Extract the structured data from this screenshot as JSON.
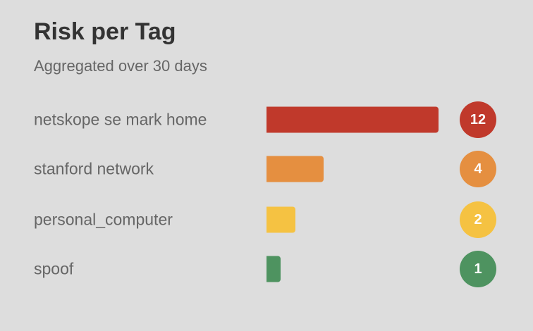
{
  "header": {
    "title": "Risk per Tag",
    "subtitle": "Aggregated over 30 days"
  },
  "chart_data": {
    "type": "bar",
    "orientation": "horizontal",
    "title": "Risk per Tag",
    "subtitle": "Aggregated over 30 days",
    "categories": [
      "netskope se mark home",
      "stanford network",
      "personal_computer",
      "spoof"
    ],
    "values": [
      12,
      4,
      2,
      1
    ],
    "value_labels": [
      "12",
      "4",
      "2",
      "1"
    ],
    "colors": [
      "#c0392b",
      "#e58f40",
      "#f5c242",
      "#4e9360"
    ],
    "xlim": [
      0,
      12
    ],
    "grid": false,
    "legend": "none"
  }
}
